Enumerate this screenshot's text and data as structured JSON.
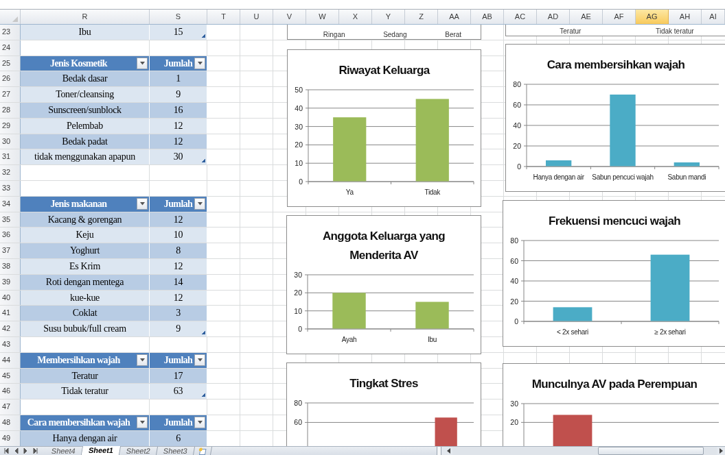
{
  "column_headers": [
    {
      "label": "R",
      "selected": false
    },
    {
      "label": "S",
      "selected": false
    },
    {
      "label": "T",
      "selected": false
    },
    {
      "label": "U",
      "selected": false
    },
    {
      "label": "V",
      "selected": false
    },
    {
      "label": "W",
      "selected": false
    },
    {
      "label": "X",
      "selected": false
    },
    {
      "label": "Y",
      "selected": false
    },
    {
      "label": "Z",
      "selected": false
    },
    {
      "label": "AA",
      "selected": false
    },
    {
      "label": "AB",
      "selected": false
    },
    {
      "label": "AC",
      "selected": false
    },
    {
      "label": "AD",
      "selected": false
    },
    {
      "label": "AE",
      "selected": false
    },
    {
      "label": "AF",
      "selected": false
    },
    {
      "label": "AG",
      "selected": true
    },
    {
      "label": "AH",
      "selected": false
    },
    {
      "label": "AI",
      "selected": false
    }
  ],
  "rows": [
    {
      "number": "23",
      "kind": "light",
      "cells": [
        "Ibu",
        "15"
      ],
      "table_end": true
    },
    {
      "number": "24",
      "kind": "blank"
    },
    {
      "number": "25",
      "kind": "header",
      "cells": [
        "Jenis Kosmetik",
        "Jumlah"
      ]
    },
    {
      "number": "26",
      "kind": "dark",
      "cells": [
        "Bedak dasar",
        "1"
      ],
      "table_end": false
    },
    {
      "number": "27",
      "kind": "light",
      "cells": [
        "Toner/cleansing",
        "9"
      ],
      "table_end": false
    },
    {
      "number": "28",
      "kind": "dark",
      "cells": [
        "Sunscreen/sunblock",
        "16"
      ],
      "table_end": false
    },
    {
      "number": "29",
      "kind": "light",
      "cells": [
        "Pelembab",
        "12"
      ],
      "table_end": false
    },
    {
      "number": "30",
      "kind": "dark",
      "cells": [
        "Bedak padat",
        "12"
      ],
      "table_end": false
    },
    {
      "number": "31",
      "kind": "light",
      "cells": [
        "tidak menggunakan apapun",
        "30"
      ],
      "table_end": true
    },
    {
      "number": "32",
      "kind": "blank"
    },
    {
      "number": "33",
      "kind": "blank"
    },
    {
      "number": "34",
      "kind": "header",
      "cells": [
        "Jenis makanan",
        "Jumlah"
      ]
    },
    {
      "number": "35",
      "kind": "dark",
      "cells": [
        "Kacang & gorengan",
        "12"
      ],
      "table_end": false
    },
    {
      "number": "36",
      "kind": "light",
      "cells": [
        "Keju",
        "10"
      ],
      "table_end": false
    },
    {
      "number": "37",
      "kind": "dark",
      "cells": [
        "Yoghurt",
        "8"
      ],
      "table_end": false
    },
    {
      "number": "38",
      "kind": "light",
      "cells": [
        "Es Krim",
        "12"
      ],
      "table_end": false
    },
    {
      "number": "39",
      "kind": "dark",
      "cells": [
        "Roti dengan mentega",
        "14"
      ],
      "table_end": false
    },
    {
      "number": "40",
      "kind": "light",
      "cells": [
        "kue-kue",
        "12"
      ],
      "table_end": false
    },
    {
      "number": "41",
      "kind": "dark",
      "cells": [
        "Coklat",
        "3"
      ],
      "table_end": false
    },
    {
      "number": "42",
      "kind": "light",
      "cells": [
        "Susu bubuk/full cream",
        "9"
      ],
      "table_end": true
    },
    {
      "number": "43",
      "kind": "blank"
    },
    {
      "number": "44",
      "kind": "header",
      "cells": [
        "Membersihkan wajah",
        "Jumlah"
      ]
    },
    {
      "number": "45",
      "kind": "dark",
      "cells": [
        "Teratur",
        "17"
      ],
      "table_end": false
    },
    {
      "number": "46",
      "kind": "light",
      "cells": [
        "Tidak teratur",
        "63"
      ],
      "table_end": true
    },
    {
      "number": "47",
      "kind": "blank"
    },
    {
      "number": "48",
      "kind": "header",
      "cells": [
        "Cara membersihkan wajah",
        "Jumlah"
      ]
    },
    {
      "number": "49",
      "kind": "dark",
      "cells": [
        "Hanya dengan air",
        "6"
      ],
      "table_end": false
    }
  ],
  "chart_fragments": [
    {
      "labels": [
        "Ringan",
        "Sedang",
        "Berat"
      ]
    },
    {
      "labels": [
        "Teratur",
        "Tidak teratur"
      ]
    }
  ],
  "charts": [
    {
      "chart_data": {
        "type": "bar",
        "title": "Riwayat Keluarga",
        "categories": [
          "Ya",
          "Tidak"
        ],
        "series": [
          {
            "color": "#9bbb59",
            "values": [
              35,
              45
            ]
          }
        ],
        "ylim": [
          0,
          50
        ],
        "grid": true,
        "yticks": [
          0,
          10,
          20,
          30,
          40,
          50
        ]
      }
    },
    {
      "chart_data": {
        "type": "bar",
        "title": "Cara membersihkan wajah",
        "categories": [
          "Hanya dengan air",
          "Sabun pencuci wajah",
          "Sabun mandi"
        ],
        "series": [
          {
            "color": "#4bacc6",
            "values": [
              6,
              70,
              4
            ]
          }
        ],
        "ylim": [
          0,
          80
        ],
        "grid": true,
        "yticks": [
          0,
          20,
          40,
          60,
          80
        ]
      }
    },
    {
      "chart_data": {
        "type": "bar",
        "title": "Anggota Keluarga yang Menderita AV",
        "categories": [
          "Ayah",
          "Ibu"
        ],
        "series": [
          {
            "color": "#9bbb59",
            "values": [
              20,
              15
            ]
          }
        ],
        "ylim": [
          0,
          30
        ],
        "grid": true,
        "yticks": [
          0,
          10,
          20,
          30
        ]
      }
    },
    {
      "chart_data": {
        "type": "bar",
        "title": "Frekuensi mencuci wajah",
        "categories": [
          "< 2x sehari",
          "≥ 2x sehari"
        ],
        "series": [
          {
            "color": "#4bacc6",
            "values": [
              14,
              66
            ]
          }
        ],
        "ylim": [
          0,
          80
        ],
        "grid": true,
        "yticks": [
          0,
          20,
          40,
          60,
          80
        ]
      }
    },
    {
      "chart_data": {
        "type": "bar",
        "title": "Tingkat Stres",
        "series": [
          {
            "color": "#c0504d",
            "values": [
              null,
              null,
              65
            ]
          }
        ],
        "ylim": [
          35,
          80
        ],
        "grid": true,
        "yticks": [
          60,
          80
        ]
      }
    },
    {
      "chart_data": {
        "type": "bar",
        "title": "Munculnya AV pada Perempuan",
        "series": [
          {
            "color": "#c0504d",
            "values": [
              24,
              null
            ]
          }
        ],
        "ylim": [
          7,
          30
        ],
        "grid": true,
        "yticks": [
          20,
          30
        ]
      }
    }
  ],
  "sheet_tabs": [
    {
      "label": "Sheet4",
      "selected": false
    },
    {
      "label": "Sheet1",
      "selected": true
    },
    {
      "label": "Sheet2",
      "selected": false
    },
    {
      "label": "Sheet3",
      "selected": false
    }
  ]
}
